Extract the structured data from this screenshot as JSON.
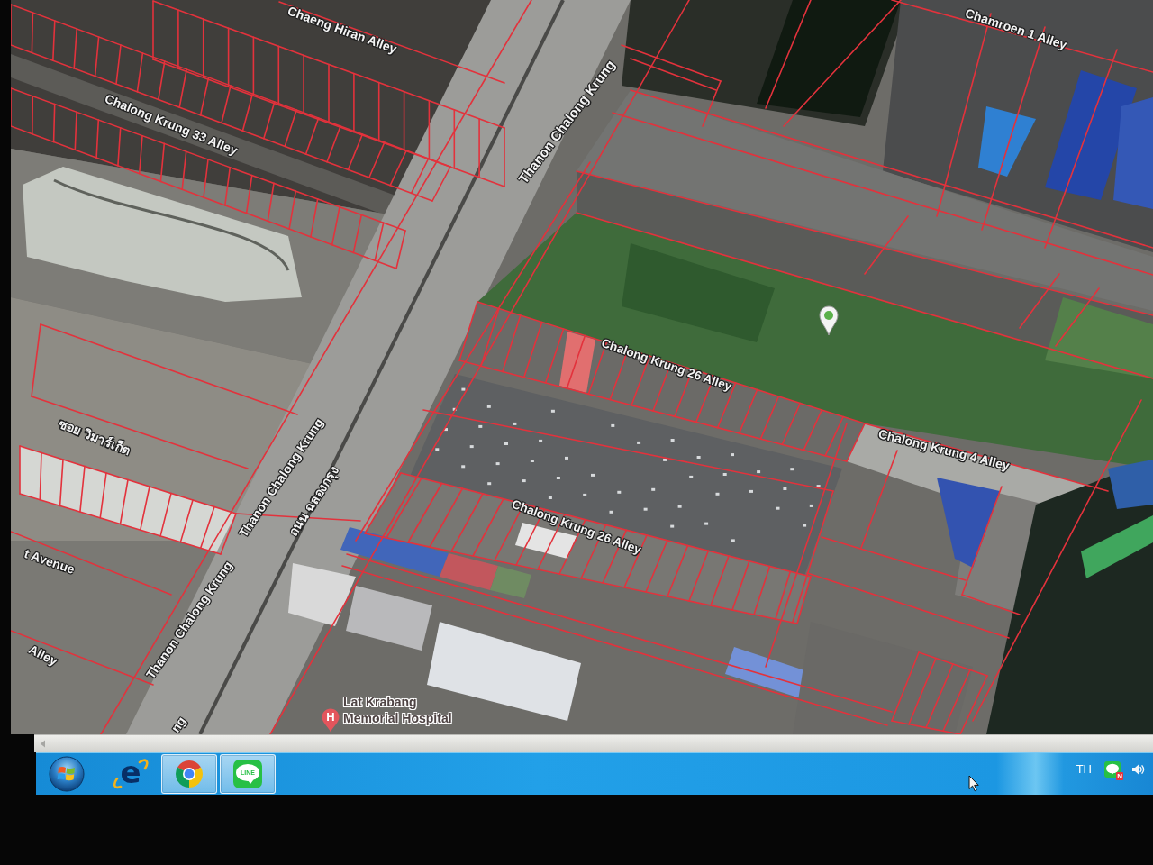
{
  "map": {
    "road_labels": [
      "Chaeng Hiran Alley",
      "Chamroen 1 Alley",
      "Chalong Krung 33 Alley",
      "Thanon Chalong Krung",
      "Chalong Krung 26 Alley",
      "ซอย วิมาร์เก็ต",
      "Chalong Krung 4 Alley",
      "Thanon Chalong Krung",
      "ถนน ฉลองกรุง",
      "Chalong Krung 26 Alley",
      "t Avenue",
      "Thanon Chalong Krung",
      "Alley",
      "ng"
    ],
    "places": [
      {
        "kind": "pin"
      },
      {
        "kind": "hospital",
        "symbol": "H",
        "name_lines": [
          "Lat Krabang",
          "Memorial Hospital"
        ]
      }
    ]
  },
  "taskbar": {
    "apps": [
      {
        "kind": "ie",
        "logo_text": "e",
        "running": false
      },
      {
        "kind": "chrome",
        "running": true
      },
      {
        "kind": "line",
        "logo_text": "LINE",
        "running": true
      }
    ],
    "tray": {
      "language": "TH",
      "icons": [
        {
          "kind": "line",
          "badge": "N"
        },
        {
          "kind": "volume"
        }
      ]
    }
  }
}
